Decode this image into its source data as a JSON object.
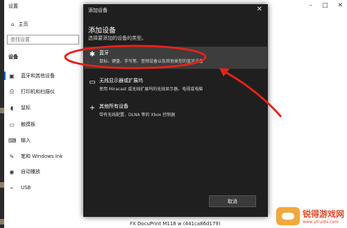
{
  "settings": {
    "title": "设置",
    "home": "主页",
    "search_placeholder": "查找设置",
    "category": "设备",
    "nav": [
      {
        "label": "蓝牙和其他设备",
        "icon": "bluetooth-devices-icon",
        "glyph": "▣"
      },
      {
        "label": "打印机和扫描仪",
        "icon": "printer-icon",
        "glyph": "⎙"
      },
      {
        "label": "鼠标",
        "icon": "mouse-icon",
        "glyph": "◖"
      },
      {
        "label": "触摸板",
        "icon": "touchpad-icon",
        "glyph": "▭"
      },
      {
        "label": "输入",
        "icon": "keyboard-icon",
        "glyph": "⌨"
      },
      {
        "label": "笔和 Windows Ink",
        "icon": "pen-icon",
        "glyph": "✎"
      },
      {
        "label": "自动播放",
        "icon": "autoplay-icon",
        "glyph": "◉"
      },
      {
        "label": "USB",
        "icon": "usb-icon",
        "glyph": "⌁"
      }
    ],
    "bottom_text": "FX DocuPrint M118 w (441ca86d179)"
  },
  "dialog": {
    "title": "添加设备",
    "heading": "添加设备",
    "subheading": "选择要添加的设备的类型。",
    "options": [
      {
        "name": "蓝牙",
        "desc": "鼠标、键盘、手写笔、音频设备以及其他类型的蓝牙设备",
        "icon": "bluetooth-icon",
        "glyph": "✱"
      },
      {
        "name": "无线显示器或扩展坞",
        "desc": "使用 Miracast 或无线扩展坞的无线显示器、电视或电脑",
        "icon": "monitor-icon",
        "glyph": "▭"
      },
      {
        "name": "其他所有设备",
        "desc": "带有无线配置、DLNA 等的 Xbox 控制器",
        "icon": "plus-icon",
        "glyph": "+"
      }
    ],
    "cancel_label": "取消"
  },
  "watermark": {
    "name": "锐得游戏网",
    "url": "www.ytruida.com"
  },
  "colors": {
    "accent": "#0067c0",
    "annotation": "#e3231a"
  }
}
